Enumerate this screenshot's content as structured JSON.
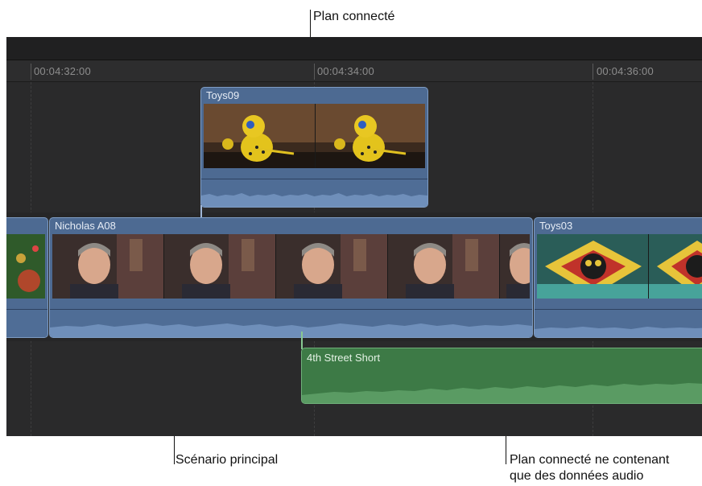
{
  "callouts": {
    "connected_clip": "Plan connecté",
    "primary_storyline": "Scénario principal",
    "audio_only_line1": "Plan connecté ne contenant",
    "audio_only_line2": "que des données audio"
  },
  "ruler": {
    "timecodes": [
      "00:04:32:00",
      "00:04:34:00",
      "00:04:36:00"
    ]
  },
  "clips": {
    "connected_video": "Toys09",
    "primary_main": "Nicholas A08",
    "primary_next": "Toys03",
    "connected_audio": "4th Street Short"
  },
  "colors": {
    "timeline_bg": "#2a2a2b",
    "video_clip": "#4d6a92",
    "audio_clip": "#3d7a46"
  }
}
